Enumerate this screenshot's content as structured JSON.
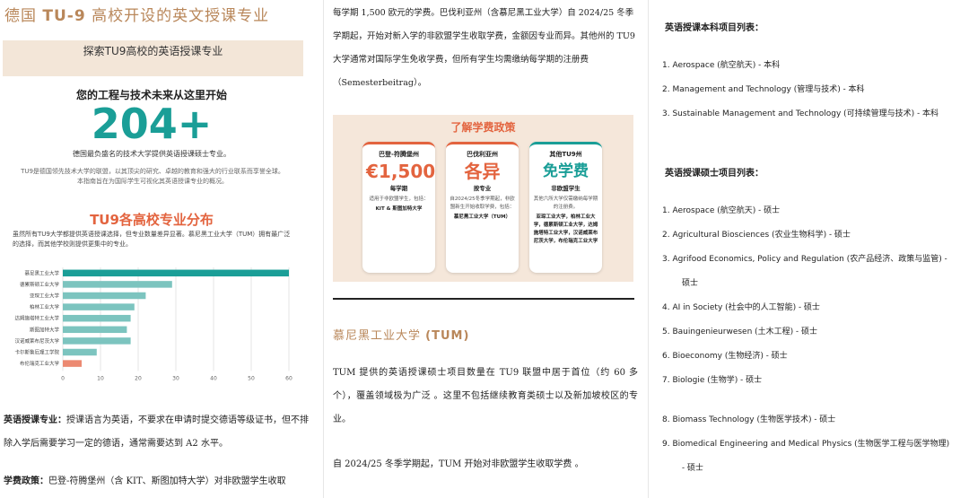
{
  "col1": {
    "title_pre": "德国 ",
    "title_bold": "TU-9",
    "title_post": " 高校开设的英文授课专业",
    "banner": "探索TU9高校的英语授课专业",
    "headline": "您的工程与技术未来从这里开始",
    "big_number": "204+",
    "sub1": "德国最负盛名的技术大学提供英语授课硕士专业。",
    "sub2": "TU9是德国领先技术大学的联盟，以其顶尖的研究、卓越的教育和强大的行业联系而享誉全球。本指南旨在为国际学生可视化其英语授课专业的概况。",
    "dist_title": "TU9各高校专业分布",
    "dist_desc": "虽然所有TU9大学都提供英语授课选择，但专业数量差异显著。慕尼黑工业大学（TUM）拥有最广泛的选择，而其他学校则提供更集中的专业。",
    "p1_label": "英语授课专业：",
    "p1_text": "授课语言为英语，不要求在申请时提交德语等级证书，但不排除入学后需要学习一定的德语，通常需要达到 A2 水平。",
    "p2_label": "学费政策：",
    "p2_text": "巴登-符腾堡州（含 KIT、斯图加特大学）对非欧盟学生收取"
  },
  "chart_data": {
    "type": "bar",
    "orientation": "horizontal",
    "categories": [
      "慕尼黑工业大学",
      "德累斯顿工业大学",
      "亚琛工业大学",
      "柏林工业大学",
      "达姆施塔特工业大学",
      "斯图加特大学",
      "汉诺威莱布尼茨大学",
      "卡尔斯鲁厄理工学院",
      "布伦瑞克工业大学"
    ],
    "values": [
      60,
      29,
      22,
      19,
      18,
      17,
      18,
      9,
      5
    ],
    "xlim": [
      0,
      60
    ],
    "xticks": [
      "0",
      "10",
      "20",
      "30",
      "40",
      "50",
      "60"
    ],
    "colors": {
      "primary": "#1a9e97",
      "secondary": "#7cc4bf",
      "last": "#ec8a72"
    },
    "grid": true
  },
  "col2": {
    "para": "每学期 1,500 欧元的学费。巴伐利亚州（含慕尼黑工业大学）自 2024/25 冬季学期起，开始对新入学的非欧盟学生收取学费，金额因专业而异。其他州的 TU9 大学通常对国际学生免收学费，但所有学生均需缴纳每学期的注册费（Semesterbeitrag）。",
    "tuition_title": "了解学费政策",
    "cards": [
      {
        "region": "巴登-符腾堡州",
        "value": "€1,500",
        "unit": "每学期",
        "note": "适用于非欧盟学生，包括：",
        "schools": "KIT & 斯图加特大学"
      },
      {
        "region": "巴伐利亚州",
        "value": "各异",
        "unit": "按专业",
        "note": "自2024/25冬季学期起，非欧盟新生开始收取学费，包括：",
        "schools": "慕尼黑工业大学（TUM）"
      },
      {
        "region": "其他TU9州",
        "value": "免学费",
        "unit": "非欧盟学生",
        "note": "其他六所大学仅需缴纳每学期的注册费。",
        "schools": "亚琛工业大学，柏林工业大学，德累斯顿工业大学，达姆施塔特工业大学，汉诺威莱布尼茨大学，布伦瑞克工业大学"
      }
    ],
    "tum_heading_zh": "慕尼黑工业大学 ",
    "tum_heading_abbr": "(TUM)",
    "tum_para": "TUM 提供的英语授课硕士项目数量在 TU9 联盟中居于首位（约 60 多个），覆盖领域极为广泛 。这里不包括继续教育类硕士以及新加坡校区的专业。",
    "tum_fee": "自 2024/25 冬季学期起，TUM 开始对非欧盟学生收取学费 。"
  },
  "col3": {
    "bachelor_title": "英语授课本科项目列表：",
    "bachelor": [
      {
        "num": "1.",
        "en": "Aerospace",
        "zh": " (航空航天) ",
        "level": "-  本科"
      },
      {
        "num": "2.",
        "en": "Management and Technology",
        "zh": " (管理与技术) ",
        "level": "-  本科"
      },
      {
        "num": "3.",
        "en": "Sustainable Management and Technology",
        "zh": " (可持续管理与技术) ",
        "level": "-  本科"
      }
    ],
    "master_title": "英语授课硕士项目列表：",
    "master": [
      {
        "num": "1.",
        "en": "Aerospace",
        "zh": " (航空航天) ",
        "level": "-  硕士"
      },
      {
        "num": "2.",
        "en": "Agricultural Biosciences",
        "zh": " (农业生物科学) ",
        "level": "-  硕士"
      },
      {
        "num": "3.",
        "en": "Agrifood Economics, Policy and Regulation",
        "zh": " (农产品经济、政策与监管) ",
        "level": "-"
      },
      {
        "num": "",
        "en": "",
        "zh": "",
        "level": "硕士"
      },
      {
        "num": "4.",
        "en": "AI in Society",
        "zh": " (社会中的人工智能) ",
        "level": "-  硕士"
      },
      {
        "num": "5.",
        "en": "Bauingenieurwesen",
        "zh": " (土木工程) ",
        "level": "-  硕士"
      },
      {
        "num": "6.",
        "en": "Bioeconomy",
        "zh": " (生物经济) ",
        "level": "-  硕士"
      },
      {
        "num": "7.",
        "en": "Biologie",
        "zh": " (生物学) ",
        "level": "-  硕士"
      },
      {
        "num": "8.",
        "en": "Biomass Technology",
        "zh": " (生物医学技术) ",
        "level": "-  硕士"
      },
      {
        "num": "9.",
        "en": "Biomedical Engineering and Medical Physics",
        "zh": " (生物医学工程与医学物理) ",
        "level": ""
      },
      {
        "num": "",
        "en": "",
        "zh": "",
        "level": "-  硕士"
      }
    ]
  }
}
